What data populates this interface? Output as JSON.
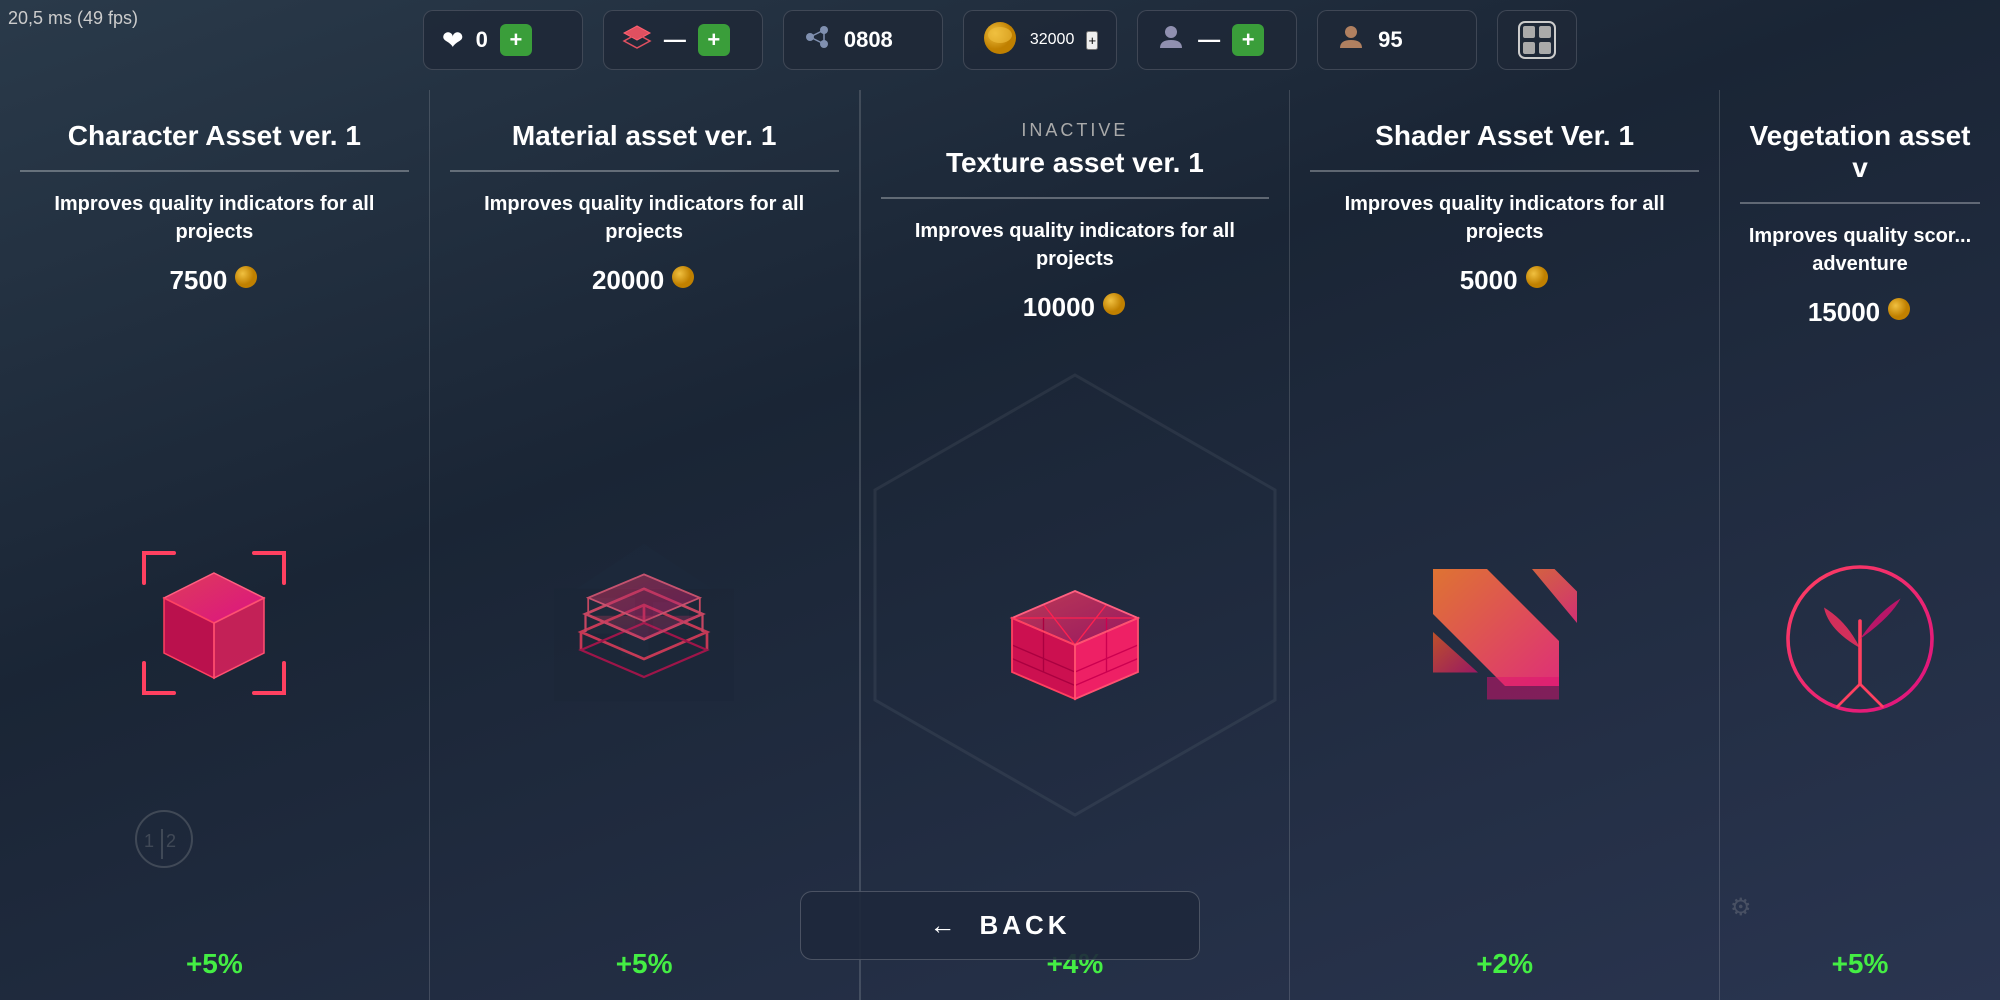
{
  "perf": {
    "time": "20,5 ms (49 fps)"
  },
  "hud": {
    "health_icon": "❤",
    "health_value": "0",
    "layers_icon": "📚",
    "layers_value": "—",
    "nodes_icon": "⬡",
    "nodes_value": "0808",
    "coin_value": "32000",
    "plus_label": "+",
    "user_icon": "👤",
    "profile_icon": "🗂"
  },
  "inactive_label": "INACTIVE",
  "cards": [
    {
      "id": "character-asset",
      "title": "Character Asset ver. 1",
      "description": "Improves quality indicators for all projects",
      "cost": "7500",
      "bonus": "+5%",
      "icon_type": "cube"
    },
    {
      "id": "material-asset",
      "title": "Material asset ver. 1",
      "description": "Improves quality indicators for all projects",
      "cost": "20000",
      "bonus": "+5%",
      "icon_type": "layers"
    },
    {
      "id": "texture-asset",
      "title": "Texture asset ver. 1",
      "description": "Improves quality indicators for all projects",
      "cost": "10000",
      "bonus": "+4%",
      "icon_type": "bricks"
    },
    {
      "id": "shader-asset",
      "title": "Shader Asset Ver. 1",
      "description": "Improves quality indicators for all projects",
      "cost": "5000",
      "bonus": "+2%",
      "icon_type": "shader"
    },
    {
      "id": "vegetation-asset",
      "title": "Vegetation asset v",
      "description": "Improves quality scor... adventure",
      "cost": "15000",
      "bonus": "+5%",
      "icon_type": "plant"
    }
  ],
  "back_button": {
    "label": "BACK",
    "arrow": "←"
  }
}
